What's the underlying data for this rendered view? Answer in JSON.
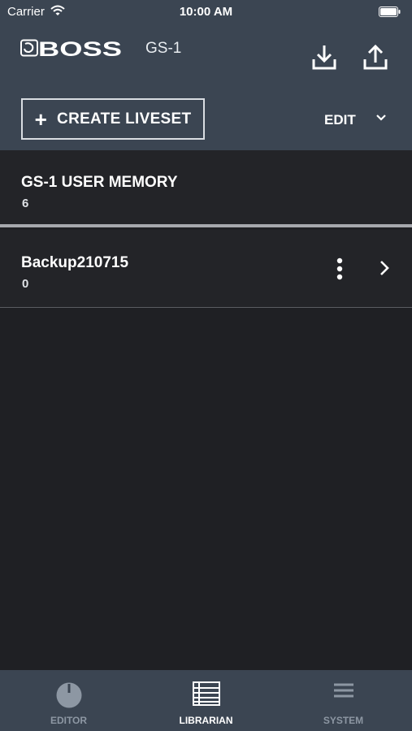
{
  "status_bar": {
    "carrier": "Carrier",
    "time": "10:00 AM"
  },
  "header": {
    "logo_text": "BOSS",
    "device": "GS-1",
    "create_label": "CREATE LIVESET",
    "edit_label": "EDIT",
    "icons": [
      "download-icon",
      "upload-icon",
      "plus-icon",
      "chevron-down-icon"
    ]
  },
  "livesets": [
    {
      "name": "GS-1 USER MEMORY",
      "count": "6"
    },
    {
      "name": "Backup210715",
      "count": "0"
    }
  ],
  "tabs": [
    {
      "label": "EDITOR",
      "icon": "knob-icon",
      "active": false
    },
    {
      "label": "LIBRARIAN",
      "icon": "list-icon",
      "active": true
    },
    {
      "label": "SYSTEM",
      "icon": "menu-icon",
      "active": false
    }
  ],
  "colors": {
    "bar_bg": "#3b4552",
    "list_bg": "#232428",
    "page_bg": "#1f2024",
    "tab_inactive": "#8d97a3",
    "tab_active": "#ffffff"
  }
}
